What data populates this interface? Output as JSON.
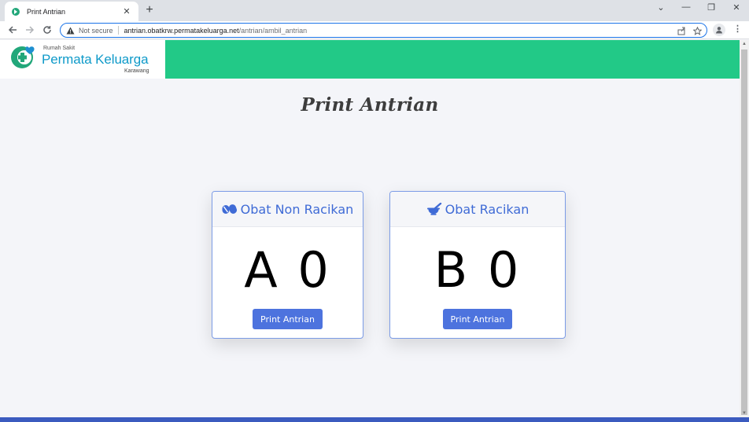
{
  "browser": {
    "tab_title": "Print Antrian",
    "security_label": "Not secure",
    "url_host": "antrian.obatkrw.permatakeluarga.net",
    "url_path": "/antrian/ambil_antrian"
  },
  "header": {
    "logo_small": "Rumah Sakit",
    "logo_main": "Permata Keluarga",
    "logo_city": "Karawang",
    "bar_color": "#22c987"
  },
  "page": {
    "title": "Print Antrian"
  },
  "cards": [
    {
      "icon": "pills-icon",
      "label": "Obat Non Racikan",
      "number": "A 0",
      "button": "Print Antrian"
    },
    {
      "icon": "mortar-pestle-icon",
      "label": "Obat Racikan",
      "number": "B 0",
      "button": "Print Antrian"
    }
  ],
  "colors": {
    "accent": "#4d73de",
    "header_text": "#3f6bd6"
  }
}
